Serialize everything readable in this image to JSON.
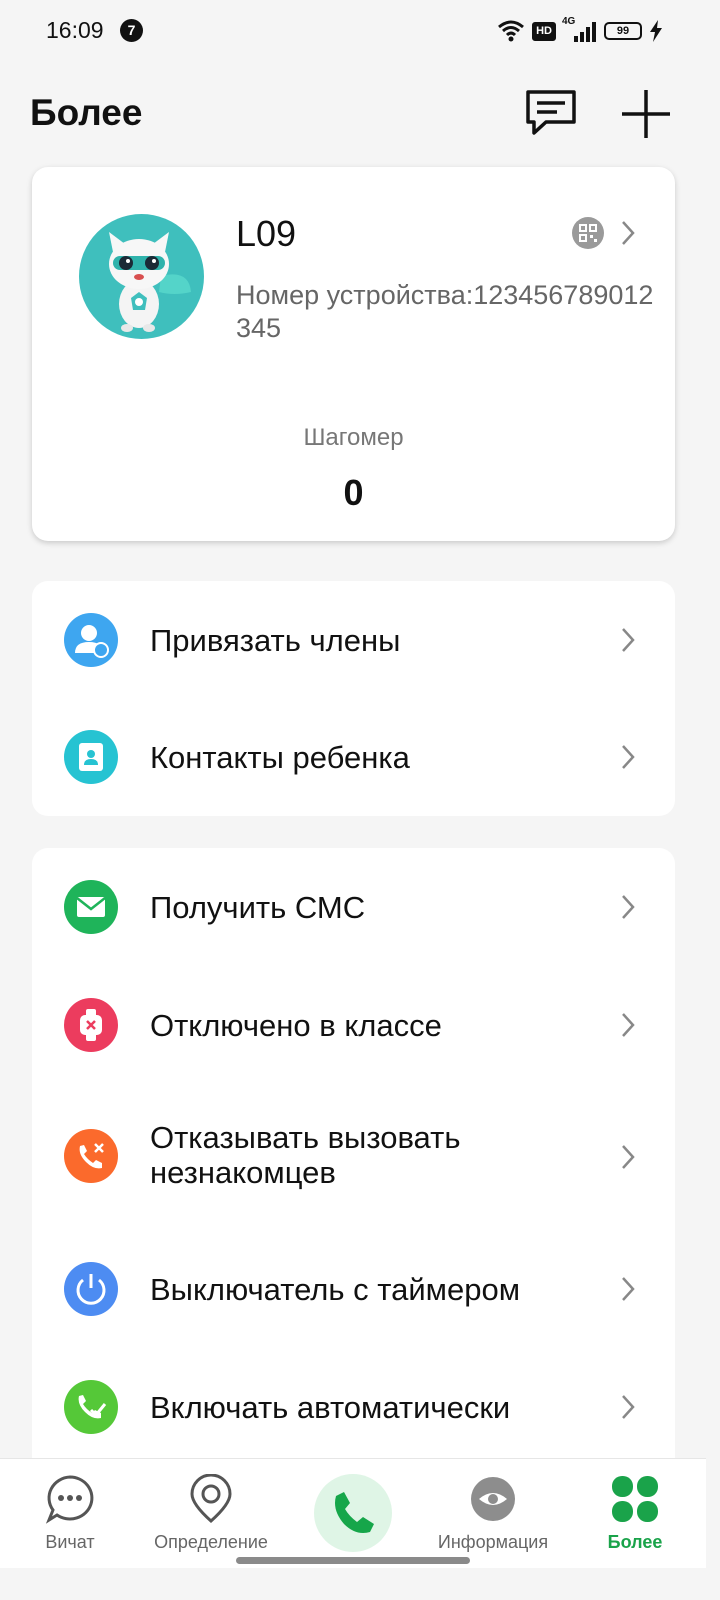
{
  "status_bar": {
    "time": "16:09",
    "notification_count": "7",
    "hd_label": "HD",
    "network_label": "4G",
    "battery": "99"
  },
  "header": {
    "title": "Более",
    "message_icon": "chat-bubble-icon",
    "add_icon": "plus-icon"
  },
  "profile": {
    "device_name": "L09",
    "device_number": "Номер устройства:123456789012345",
    "step_label": "Шагомер",
    "step_value": "0"
  },
  "menu_group_1": [
    {
      "label": "Привязать члены",
      "icon": "bind-members-icon",
      "color": "#3ea6f0"
    },
    {
      "label": "Контакты ребенка",
      "icon": "child-contacts-icon",
      "color": "#26c3d2"
    }
  ],
  "menu_group_2": [
    {
      "label": "Получить СМС",
      "icon": "sms-icon",
      "color": "#1fb45a"
    },
    {
      "label": "Отключено в классе",
      "icon": "class-mode-icon",
      "color": "#ec3c5e"
    },
    {
      "label": "Отказывать вызовать незнакомцев",
      "icon": "reject-stranger-icon",
      "color": "#fb6a2c"
    },
    {
      "label": "Выключатель с таймером",
      "icon": "timer-power-icon",
      "color": "#4d8cf2"
    },
    {
      "label": "Включать автоматически",
      "icon": "auto-on-icon",
      "color": "#55c838"
    }
  ],
  "bottom_nav": [
    {
      "label": "Вичат",
      "icon": "chat-dots-icon"
    },
    {
      "label": "Определение",
      "icon": "location-pin-icon"
    },
    {
      "label": "",
      "icon": "phone-call-icon"
    },
    {
      "label": "Информация",
      "icon": "eye-icon"
    },
    {
      "label": "Более",
      "icon": "more-clover-icon",
      "active": true
    }
  ],
  "colors": {
    "accent_green": "#1aa34a",
    "background": "#f5f5f5"
  }
}
